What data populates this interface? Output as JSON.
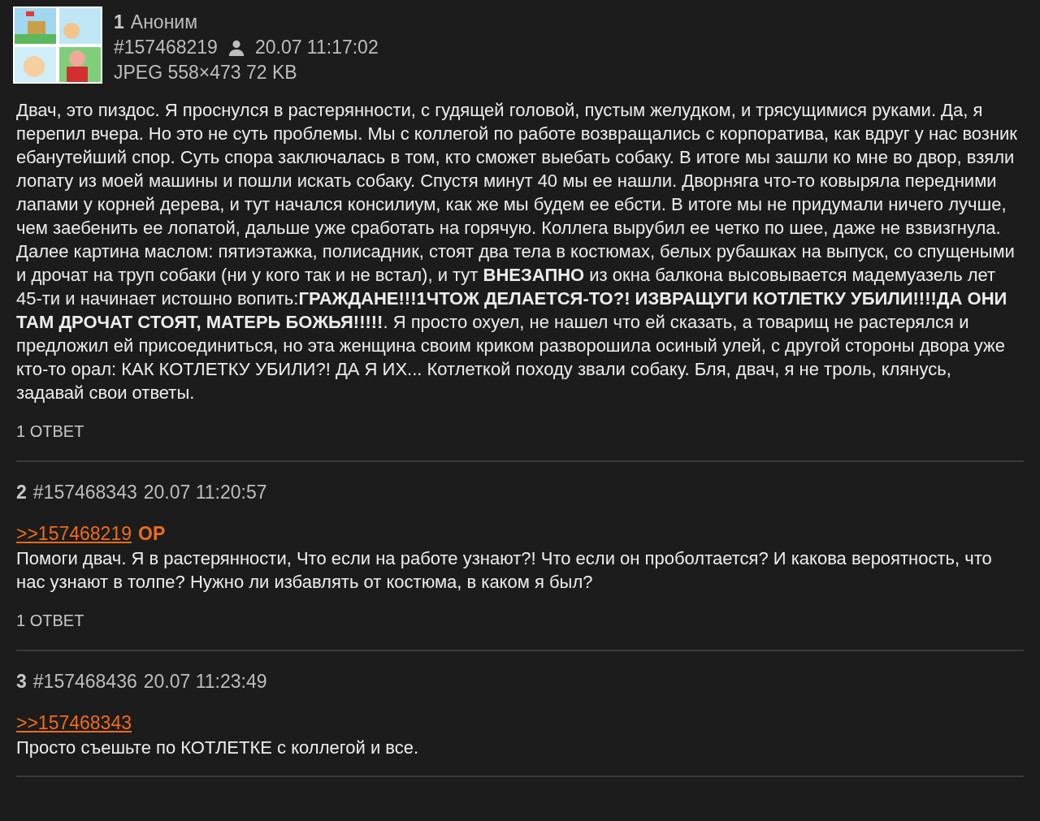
{
  "posts": [
    {
      "number": "1",
      "name": "Аноним",
      "id": "#157468219",
      "date": "20.07 11:17:02",
      "file": "JPEG 558×473 72 KB",
      "body": "Двач, это пиздос. Я проснулся в растерянности, с гудящей головой, пустым желудком, и трясущимися руками. Да, я перепил вчера. Но это не суть проблемы. Мы с коллегой по работе возвращались с корпоратива, как вдруг у нас возник ебанутейший спор. Суть спора заключалась в том, кто сможет выебать собаку. В итоге мы зашли ко мне во двор, взяли лопату из моей машины и пошли искать собаку. Спустя минут 40 мы ее нашли. Дворняга что-то ковыряла передними лапами у корней дерева, и тут начался консилиум, как же мы будем ее ебсти. В итоге мы не придумали ничего лучше, чем заебенить ее лопатой, дальше уже сработать на горячую. Коллега вырубил ее четко по шее, даже не взвизгнула. Далее картина маслом: пятиэтажка, полисадник, стоят два тела в костюмах, белых рубашках на выпуск, со спущеными и дрочат на труп собаки (ни у кого так и не встал), и тут **ВНЕЗАПНО** из окна балкона высовывается мадемуазель лет 45-ти и начинает истошно вопить:**ГРАЖДАНЕ!!!1ЧТОЖ ДЕЛАЕТСЯ-ТО?! ИЗВРАЩУГИ КОТЛЕТКУ УБИЛИ!!!!ДА ОНИ ТАМ ДРОЧАТ СТОЯТ, МАТЕРЬ БОЖЬЯ!!!!!**. Я просто охуел, не нашел что ей сказать, а товарищ не растерялся и предложил ей присоединиться, но эта женщина своим криком разворошила осиный улей, с другой стороны двора уже кто-то орал: КАК КОТЛЕТКУ УБИЛИ?! ДА Я ИХ... Котлеткой походу звали собаку. Бля, двач, я не троль, клянусь, задавай свои ответы.",
      "replies": "1 ОТВЕТ"
    },
    {
      "number": "2",
      "id": "#157468343",
      "date": "20.07 11:20:57",
      "reply_link": ">>157468219",
      "op_mark": "OP",
      "body": "Помоги двач. Я в растерянности, Что если на работе узнают?! Что если он проболтается? И какова вероятность, что нас узнают в толпе? Нужно ли избавлять от костюма, в каком я был?",
      "replies": "1 ОТВЕТ"
    },
    {
      "number": "3",
      "id": "#157468436",
      "date": "20.07 11:23:49",
      "reply_link": ">>157468343",
      "body": "Просто съешьте по КОТЛЕТКЕ с коллегой и все."
    }
  ]
}
